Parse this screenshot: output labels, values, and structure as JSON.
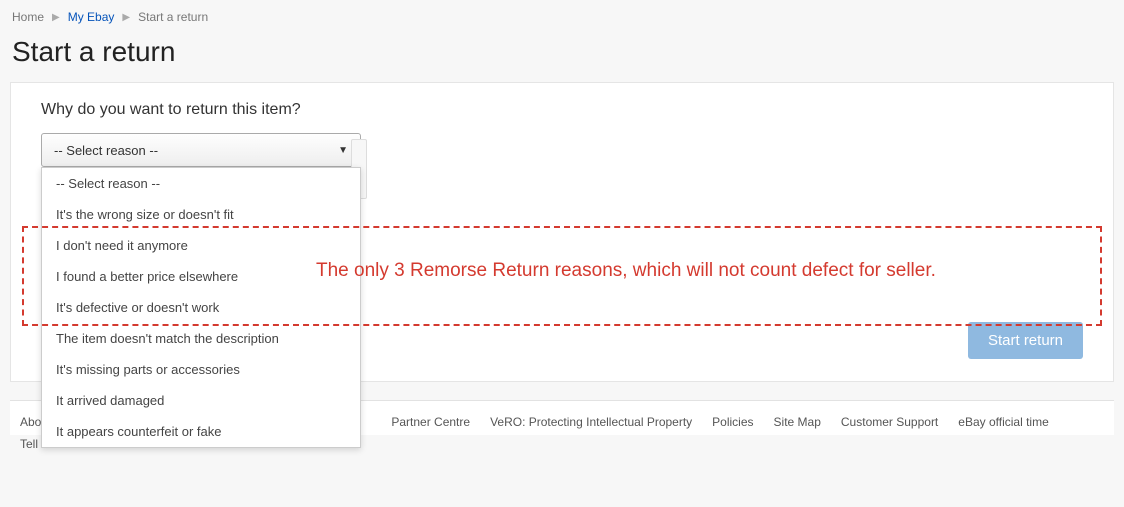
{
  "breadcrumb": {
    "home": "Home",
    "myebay": "My Ebay",
    "current": "Start a return"
  },
  "page_title": "Start a return",
  "form": {
    "question": "Why do you want to return this item?",
    "selected": "-- Select reason --",
    "options": [
      "-- Select reason --",
      "It's the wrong size or doesn't fit",
      "I don't need it anymore",
      "I found a better price elsewhere",
      "It's defective or doesn't work",
      "The item doesn't match the description",
      "It's missing parts or accessories",
      "It arrived damaged",
      "It appears counterfeit or fake"
    ],
    "submit_label": "Start return"
  },
  "annotation": {
    "text": "The only 3 Remorse Return reasons, which will not count defect for seller."
  },
  "footer": {
    "lead1": "About",
    "lead2": "Tell u",
    "links": [
      "Partner Centre",
      "VeRO: Protecting Intellectual Property",
      "Policies",
      "Site Map",
      "Customer Support",
      "eBay official time"
    ]
  }
}
